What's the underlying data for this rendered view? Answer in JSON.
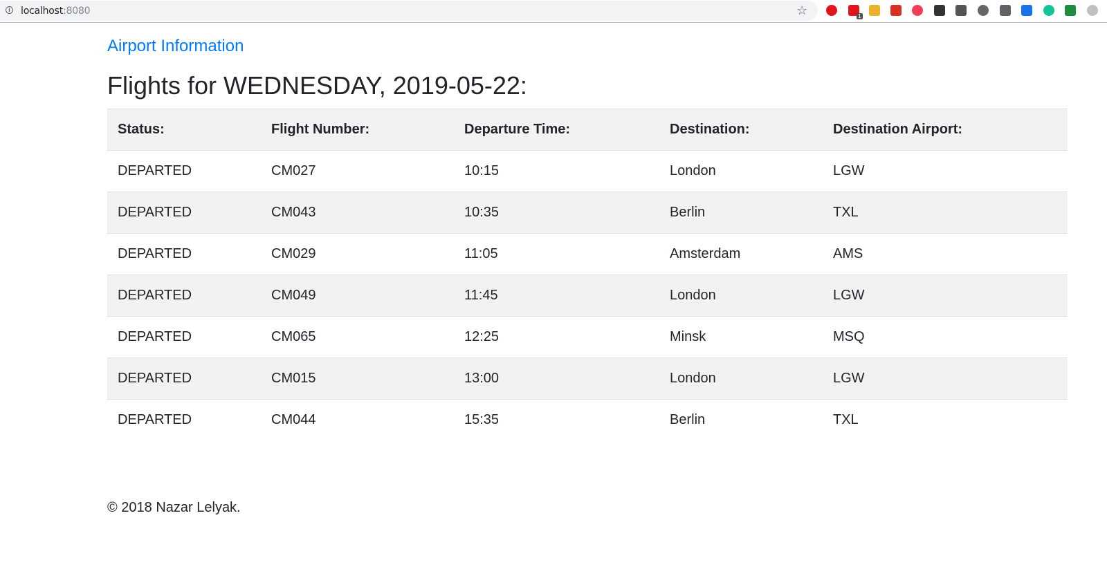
{
  "browser": {
    "url_host": "localhost",
    "url_port": ":8080",
    "extensions": [
      {
        "name": "opera-icon",
        "color": "#e0161c"
      },
      {
        "name": "calendar-extension-icon",
        "color": "#e0161c",
        "badge": "1"
      },
      {
        "name": "slack-icon",
        "color": "#ecb22e"
      },
      {
        "name": "gmail-icon",
        "color": "#d93025"
      },
      {
        "name": "pocket-icon",
        "color": "#ef4056"
      },
      {
        "name": "readium-icon",
        "color": "#333333"
      },
      {
        "name": "camera-extension-icon",
        "color": "#555555"
      },
      {
        "name": "settings-extension-icon",
        "color": "#666666"
      },
      {
        "name": "save-to-pocket-icon",
        "color": "#5f6368"
      },
      {
        "name": "font-extension-icon",
        "color": "#1a73e8"
      },
      {
        "name": "grammarly-icon",
        "color": "#15c39a"
      },
      {
        "name": "green-square-extension-icon",
        "color": "#1e8e3e"
      },
      {
        "name": "profile-icon",
        "color": "#c0c0c0"
      }
    ]
  },
  "nav": {
    "brand": "Airport Information"
  },
  "page": {
    "title": "Flights for WEDNESDAY, 2019-05-22:"
  },
  "table": {
    "headers": [
      "Status:",
      "Flight Number:",
      "Departure Time:",
      "Destination:",
      "Destination Airport:"
    ],
    "rows": [
      [
        "DEPARTED",
        "CM027",
        "10:15",
        "London",
        "LGW"
      ],
      [
        "DEPARTED",
        "CM043",
        "10:35",
        "Berlin",
        "TXL"
      ],
      [
        "DEPARTED",
        "CM029",
        "11:05",
        "Amsterdam",
        "AMS"
      ],
      [
        "DEPARTED",
        "CM049",
        "11:45",
        "London",
        "LGW"
      ],
      [
        "DEPARTED",
        "CM065",
        "12:25",
        "Minsk",
        "MSQ"
      ],
      [
        "DEPARTED",
        "CM015",
        "13:00",
        "London",
        "LGW"
      ],
      [
        "DEPARTED",
        "CM044",
        "15:35",
        "Berlin",
        "TXL"
      ]
    ]
  },
  "footer": {
    "text": "© 2018 Nazar Lelyak."
  },
  "colors": {
    "link": "#007bff",
    "stripe": "#f2f2f2",
    "text": "#212529"
  }
}
